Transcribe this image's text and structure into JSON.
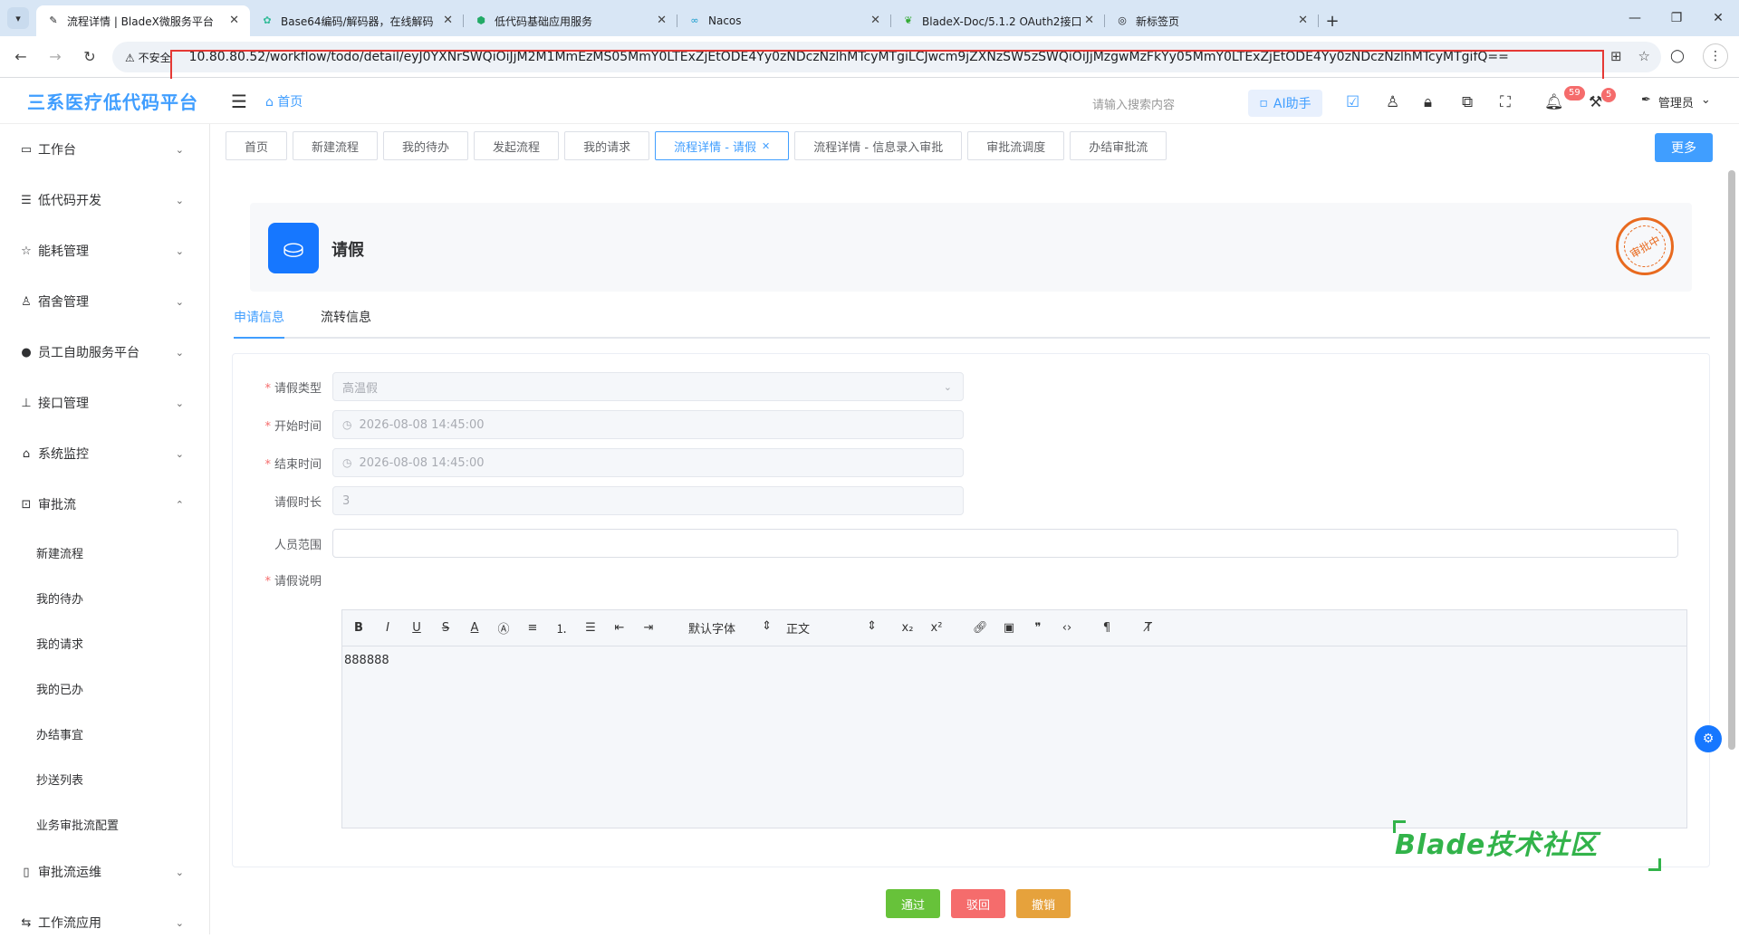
{
  "browser": {
    "tabs": [
      {
        "title": "流程详情 | BladeX微服务平台",
        "favicon": "pen-icon",
        "active": true
      },
      {
        "title": "Base64编码/解码器，在线解码",
        "favicon": "gear-icon",
        "active": false
      },
      {
        "title": "低代码基础应用服务",
        "favicon": "shield-icon",
        "active": false
      },
      {
        "title": "Nacos",
        "favicon": "infinity-icon",
        "active": false
      },
      {
        "title": "BladeX-Doc/5.1.2 OAuth2接口",
        "favicon": "book-icon",
        "active": false
      },
      {
        "title": "新标签页",
        "favicon": "chrome-icon",
        "active": false
      }
    ],
    "security_label": "不安全",
    "url": "10.80.80.52/workflow/todo/detail/eyJ0YXNrSWQiOiJjM2M1MmEzMS05MmY0LTExZjEtODE4Yy0zNDczNzlhMTcyMTgiLCJwcm9jZXNzSW5zSWQiOiJjMzgwMzFkYy05MmY0LTExZjEtODE4Yy0zNDczNzlhMTcyMTgifQ=="
  },
  "header": {
    "logo": "三系医疗低代码平台",
    "home": "首页",
    "search_placeholder": "请输入搜索内容",
    "ai_label": "AI助手",
    "bell_badge": "59",
    "tool_badge": "5",
    "user": "管理员"
  },
  "sidebar": {
    "items": [
      {
        "label": "工作台",
        "icon": "monitor-icon"
      },
      {
        "label": "低代码开发",
        "icon": "list-icon"
      },
      {
        "label": "能耗管理",
        "icon": "star-icon"
      },
      {
        "label": "宿舍管理",
        "icon": "user-icon"
      },
      {
        "label": "员工自助服务平台",
        "icon": "github-icon"
      },
      {
        "label": "接口管理",
        "icon": "org-icon"
      },
      {
        "label": "系统监控",
        "icon": "bank-icon"
      },
      {
        "label": "审批流",
        "icon": "code-icon"
      }
    ],
    "sub_items": [
      "新建流程",
      "我的待办",
      "我的请求",
      "我的已办",
      "办结事宜",
      "抄送列表",
      "业务审批流配置"
    ],
    "bottom_items": [
      {
        "label": "审批流运维",
        "icon": "book-icon"
      },
      {
        "label": "工作流应用",
        "icon": "flow-icon"
      }
    ]
  },
  "tagbar": {
    "tags": [
      "首页",
      "新建流程",
      "我的待办",
      "发起流程",
      "我的请求",
      "流程详情 - 请假",
      "流程详情 - 信息录入审批",
      "审批流调度",
      "办结审批流"
    ],
    "active_index": 5,
    "more": "更多"
  },
  "detail": {
    "title": "请假",
    "stamp": "审批中",
    "tabs": [
      "申请信息",
      "流转信息"
    ]
  },
  "form": {
    "leave_type_label": "请假类型",
    "leave_type_value": "高温假",
    "start_label": "开始时间",
    "start_value": "2026-08-08 14:45:00",
    "end_label": "结束时间",
    "end_value": "2026-08-08 14:45:00",
    "duration_label": "请假时长",
    "duration_value": "3",
    "scope_label": "人员范围",
    "desc_label": "请假说明",
    "editor_font": "默认字体",
    "editor_size": "正文",
    "editor_content": "888888"
  },
  "watermark": "Blade技术社区",
  "actions": {
    "approve": "通过",
    "reject": "驳回",
    "revoke": "撤销"
  },
  "colors": {
    "primary": "#409eff",
    "approve": "#67c23a",
    "reject": "#f56c6c",
    "revoke": "#e6a23c",
    "stamp": "#e86a1f",
    "watermark": "#32b34a"
  }
}
